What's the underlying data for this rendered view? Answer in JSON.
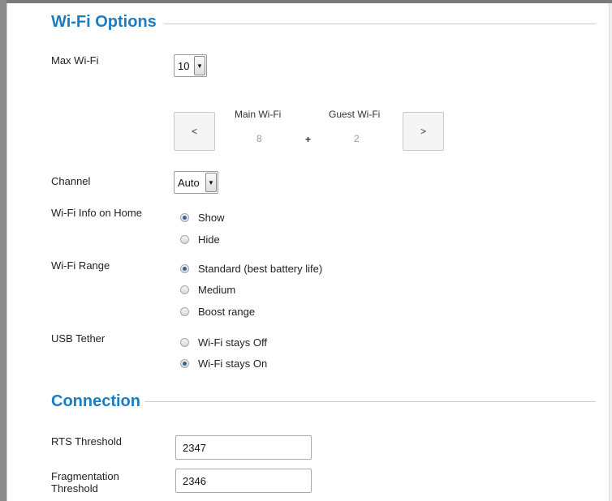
{
  "wifi_options": {
    "title": "Wi-Fi Options",
    "max_wifi": {
      "label": "Max Wi-Fi",
      "value": "10"
    },
    "split": {
      "prev_label": "<",
      "next_label": ">",
      "main_label": "Main Wi-Fi",
      "guest_label": "Guest Wi-Fi",
      "main_value": "8",
      "plus": "+",
      "guest_value": "2"
    },
    "channel": {
      "label": "Channel",
      "value": "Auto"
    },
    "info_on_home": {
      "label": "Wi-Fi Info on Home",
      "options": [
        {
          "label": "Show",
          "checked": true
        },
        {
          "label": "Hide",
          "checked": false
        }
      ]
    },
    "range": {
      "label": "Wi-Fi Range",
      "options": [
        {
          "label": "Standard (best battery life)",
          "checked": true
        },
        {
          "label": "Medium",
          "checked": false
        },
        {
          "label": "Boost range",
          "checked": false
        }
      ]
    },
    "usb_tether": {
      "label": "USB Tether",
      "options": [
        {
          "label": "Wi-Fi stays Off",
          "checked": false
        },
        {
          "label": "Wi-Fi stays On",
          "checked": true
        }
      ]
    }
  },
  "connection": {
    "title": "Connection",
    "rts": {
      "label": "RTS Threshold",
      "value": "2347"
    },
    "fragmentation": {
      "label_line1": "Fragmentation",
      "label_line2": "Threshold",
      "value": "2346"
    }
  },
  "icons": {
    "dropdown_arrow": "▼"
  },
  "colors": {
    "accent": "#1a7dc4",
    "radio_dot": "#3a5fa0"
  }
}
